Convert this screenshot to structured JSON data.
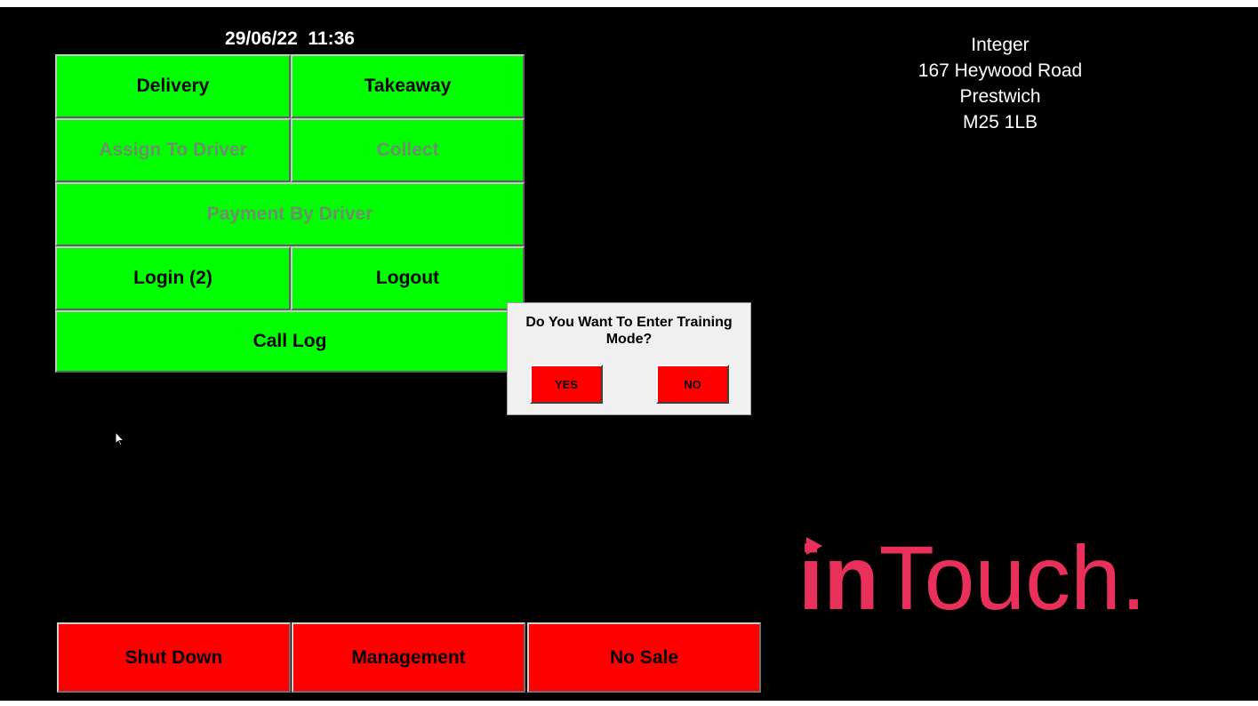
{
  "header": {
    "datetime": "29/06/22  11:36"
  },
  "menu": {
    "delivery": "Delivery",
    "takeaway": "Takeaway",
    "assign_to_driver": "Assign To Driver",
    "collect": "Collect",
    "payment_by_driver": "Payment By Driver",
    "login": "Login (2)",
    "logout": "Logout",
    "call_log": "Call Log"
  },
  "footer": {
    "shut_down": "Shut Down",
    "management": "Management",
    "no_sale": "No Sale"
  },
  "address": {
    "name": "Integer",
    "street": "167 Heywood Road",
    "town": "Prestwich",
    "postcode": "M25 1LB"
  },
  "dialog": {
    "message": "Do You Want To Enter Training Mode?",
    "yes": "YES",
    "no": "NO"
  },
  "logo": {
    "bold_part": "in",
    "light_part": "Touch."
  },
  "colors": {
    "active_button": "#00ff00",
    "danger_button": "#ff0000",
    "disabled_text": "#6e8e6e",
    "brand": "#e8305a",
    "background": "#000000"
  }
}
